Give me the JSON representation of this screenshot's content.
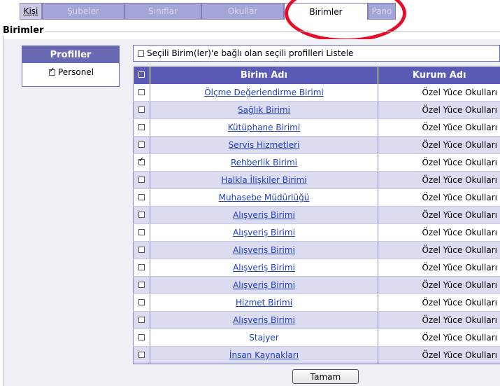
{
  "tabs": [
    {
      "label": "Kişi"
    },
    {
      "label": "Şubeler"
    },
    {
      "label": "Sınıflar"
    },
    {
      "label": "Okullar"
    },
    {
      "label": "Birimler"
    },
    {
      "label": "Pano"
    }
  ],
  "section": {
    "title": "Birimler"
  },
  "profiles": {
    "header": "Profiller",
    "items": [
      {
        "label": "Personel",
        "checked": true
      }
    ]
  },
  "filter": {
    "label": "Seçili Birim(ler)'e bağlı olan seçili profilleri Listele",
    "checked": false
  },
  "table": {
    "headers": {
      "name": "Birim Adı",
      "institution": "Kurum Adı"
    },
    "rows": [
      {
        "name": "Ölçme Değerlendirme Birimi",
        "institution": "Özel Yüce Okulları",
        "checked": false
      },
      {
        "name": "Sağlık Birimi",
        "institution": "Özel Yüce Okulları",
        "checked": false
      },
      {
        "name": "Kütüphane Birimi",
        "institution": "Özel Yüce Okulları",
        "checked": false
      },
      {
        "name": "Servis Hizmetleri",
        "institution": "Özel Yüce Okulları",
        "checked": false
      },
      {
        "name": "Rehberlik Birimi",
        "institution": "Özel Yüce Okulları",
        "checked": true
      },
      {
        "name": "Halkla İlişkiler Birimi",
        "institution": "Özel Yüce Okulları",
        "checked": false
      },
      {
        "name": "Muhasebe Müdürlüğü",
        "institution": "Özel Yüce Okulları",
        "checked": false
      },
      {
        "name": "Alışveriş Birimi",
        "institution": "Özel Yüce Okulları",
        "checked": false
      },
      {
        "name": "Alışveriş Birimi",
        "institution": "Özel Yüce Okulları",
        "checked": false
      },
      {
        "name": "Alışveriş Birimi",
        "institution": "Özel Yüce Okulları",
        "checked": false
      },
      {
        "name": "Alışveriş Birimi",
        "institution": "Özel Yüce Okulları",
        "checked": false
      },
      {
        "name": "Alışveriş Birimi",
        "institution": "Özel Yüce Okulları",
        "checked": false
      },
      {
        "name": "Hizmet Birimi",
        "institution": "Özel Yüce Okulları",
        "checked": false
      },
      {
        "name": "Alışveriş Birimi",
        "institution": "Özel Yüce Okulları",
        "checked": false
      },
      {
        "name": "Stajyer",
        "institution": "Özel Yüce Okulları",
        "checked": false,
        "link": false
      },
      {
        "name": "İnsan Kaynakları",
        "institution": "Özel Yüce Okulları",
        "checked": false
      }
    ]
  },
  "actions": {
    "ok_label": "Tamam"
  },
  "colors": {
    "accent": "#5b5bb7",
    "highlight_circle": "#e4102b",
    "link": "#1f3fc2"
  }
}
